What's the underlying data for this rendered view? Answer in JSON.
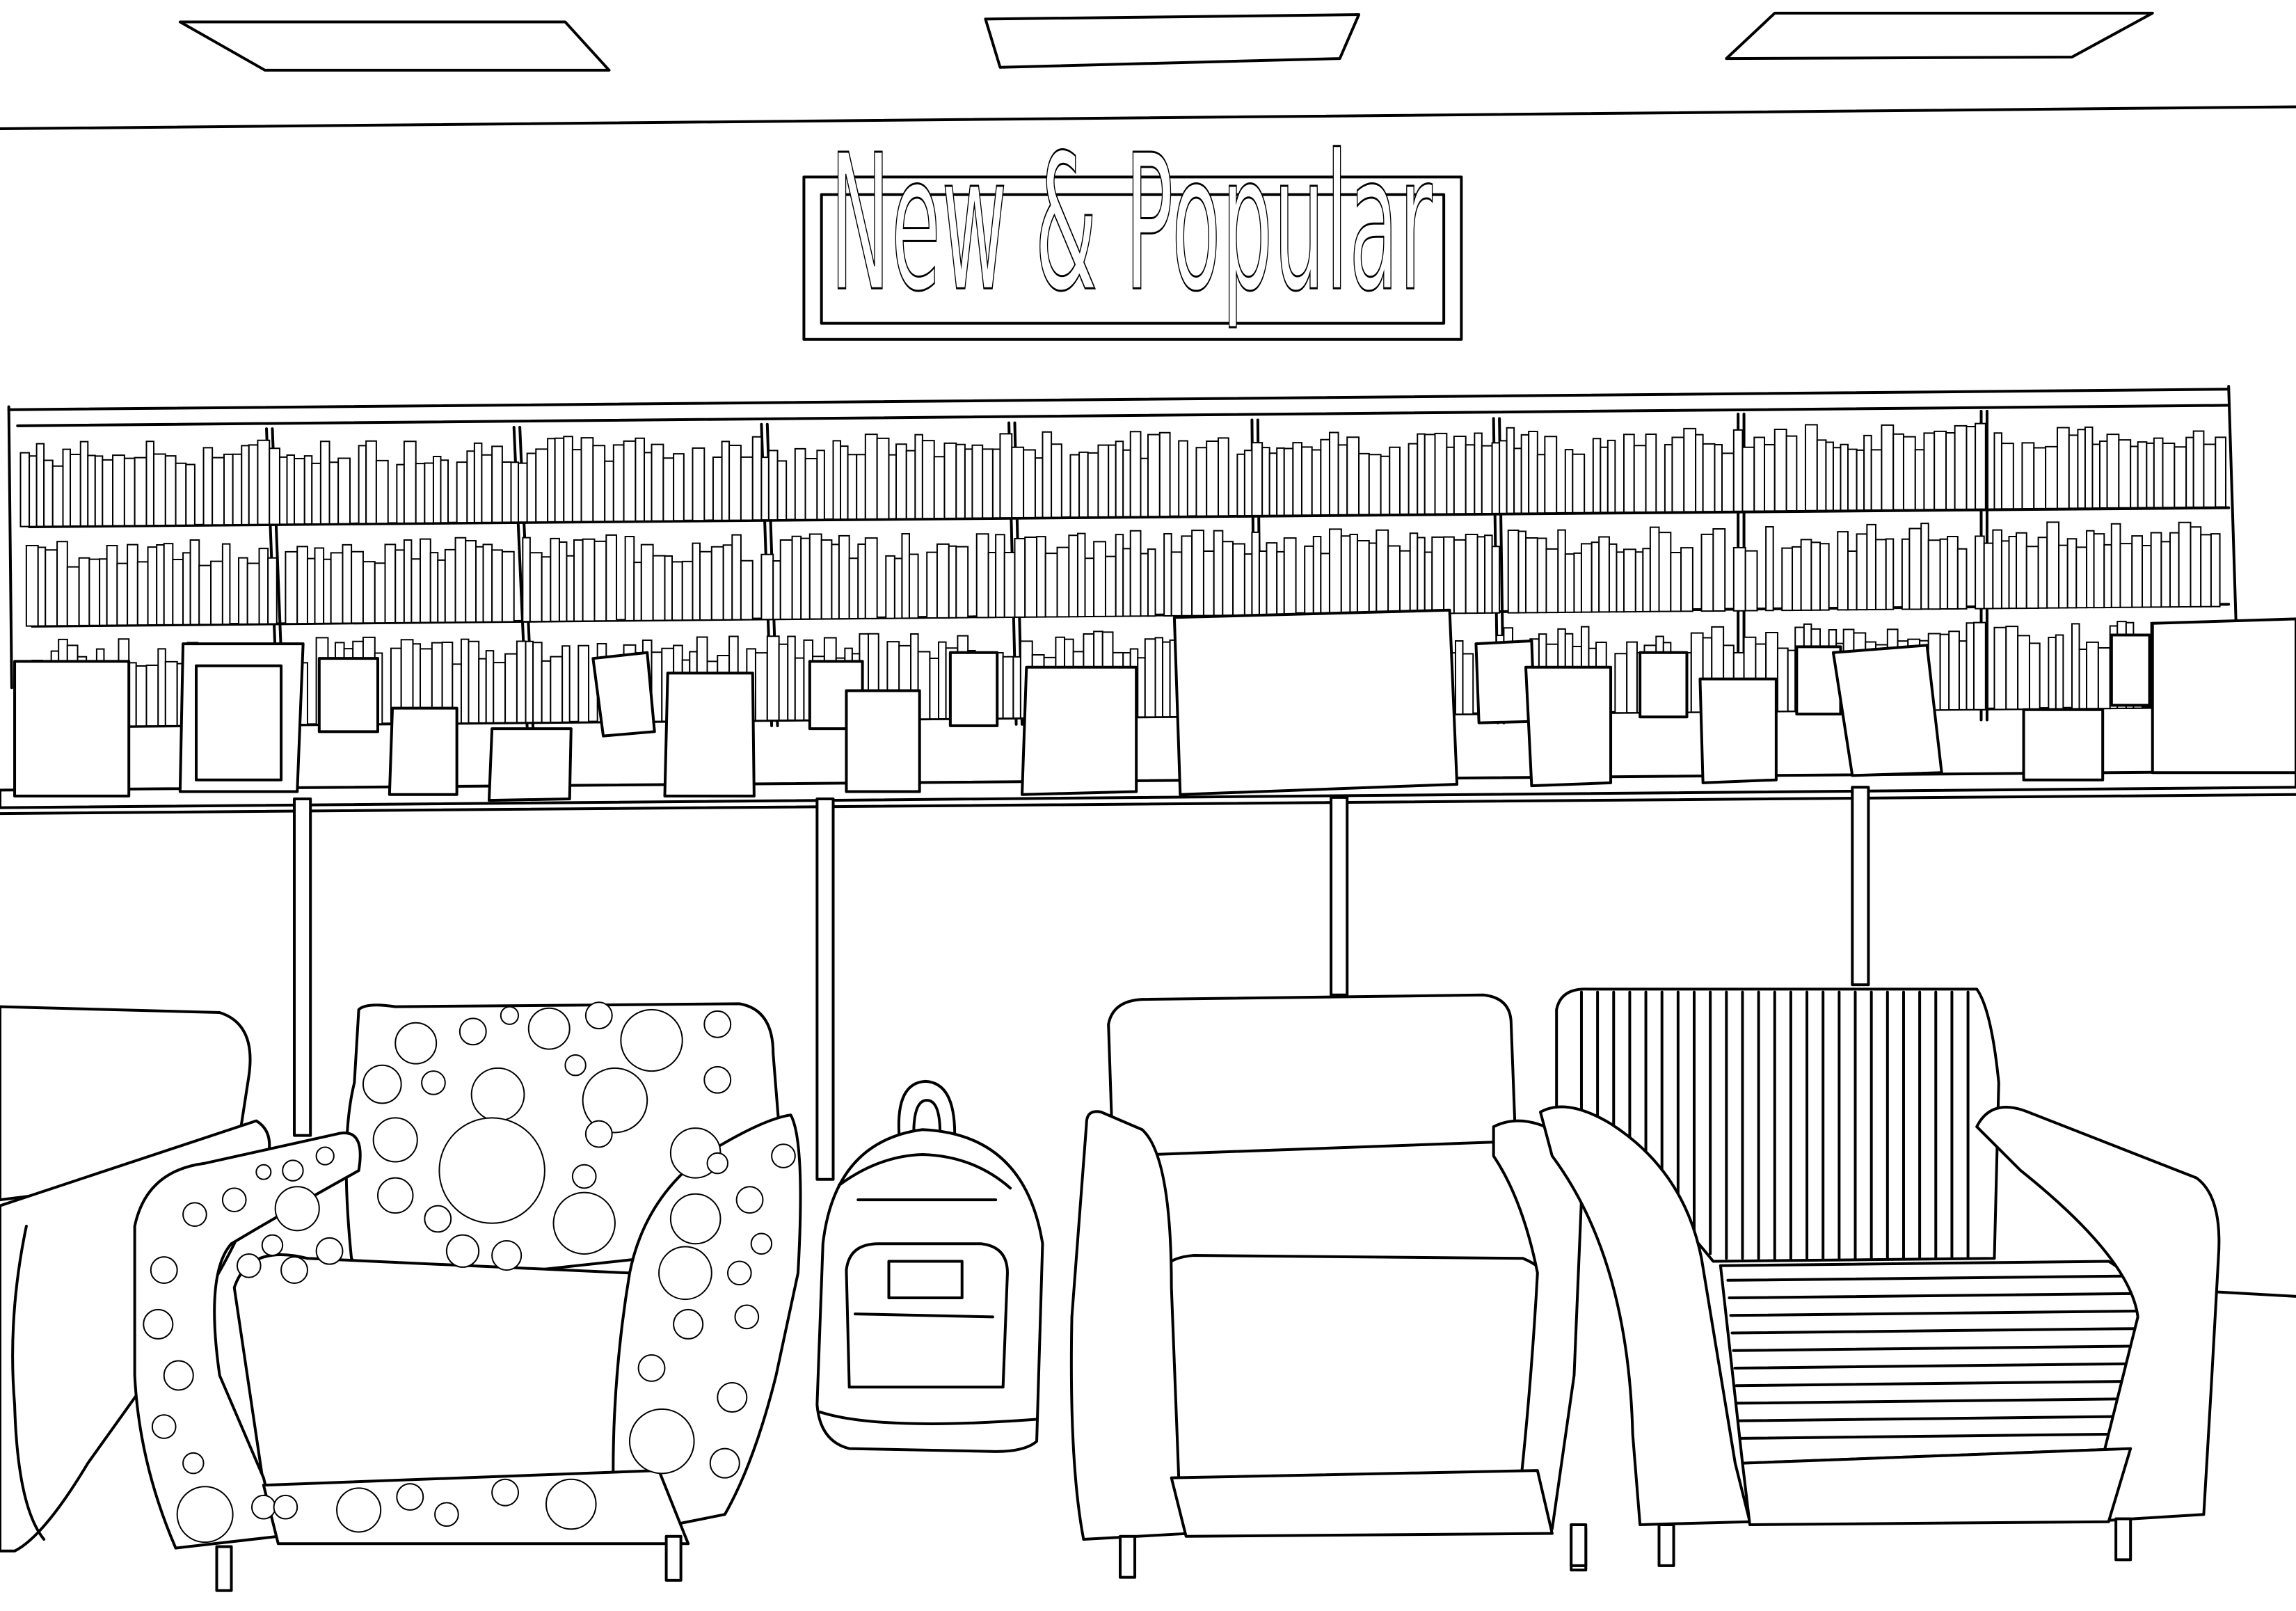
{
  "sign": {
    "label": "New & Popular"
  },
  "style": {
    "line_color": "#000000",
    "background": "#ffffff"
  },
  "objects": [
    "ceiling-light-panel",
    "ceiling-light-panel",
    "ceiling-light-panel",
    "new-and-popular-sign",
    "bookshelf-wall",
    "display-shelf",
    "book-display",
    "sofa-left-edge",
    "polka-dot-armchair",
    "backpack",
    "plain-armchair",
    "striped-armchair"
  ]
}
